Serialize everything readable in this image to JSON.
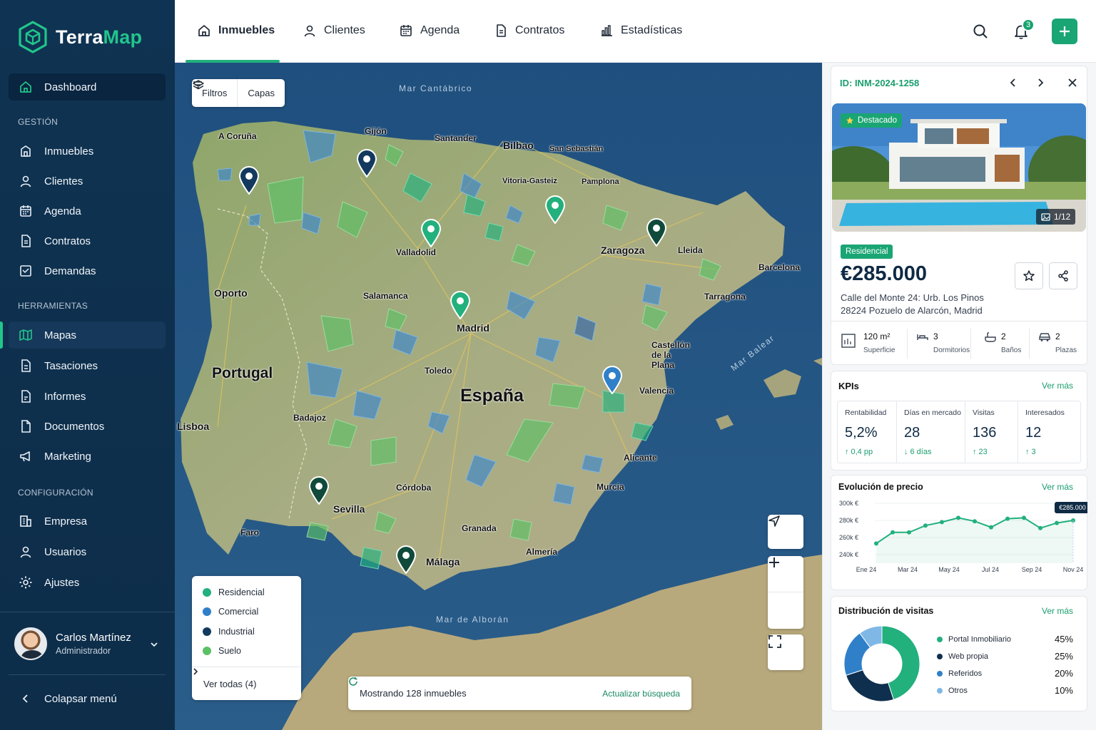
{
  "app": {
    "brand_a": "Terra",
    "brand_b": "Map"
  },
  "sidebar": {
    "dashboard": "Dashboard",
    "sections": {
      "gestion": "GESTIÓN",
      "herramientas": "HERRAMIENTAS",
      "configuracion": "CONFIGURACIÓN"
    },
    "gestion_items": [
      "Inmuebles",
      "Clientes",
      "Agenda",
      "Contratos",
      "Demandas"
    ],
    "herramientas_items": [
      "Mapas",
      "Tasaciones",
      "Informes",
      "Documentos",
      "Marketing"
    ],
    "config_items": [
      "Empresa",
      "Usuarios",
      "Ajustes"
    ],
    "user": {
      "name": "Carlos Martínez",
      "role": "Administrador"
    },
    "collapse": "Colapsar menú"
  },
  "topbar": {
    "tabs": [
      "Inmuebles",
      "Clientes",
      "Agenda",
      "Contratos",
      "Estadísticas"
    ],
    "active_tab": "Inmuebles",
    "notification_count": "3"
  },
  "map": {
    "toolbar": {
      "filters": "Filtros",
      "layers": "Capas"
    },
    "seas": {
      "cantabrico": "Mar Cantábrico",
      "balear": "Mar Balear",
      "alboran": "Mar de Alborán"
    },
    "countries": {
      "portugal": "Portugal",
      "espana": "España"
    },
    "cities": {
      "coruna": "A Coruña",
      "gijon": "Gijón",
      "santander": "Santander",
      "bilbao": "Bilbao",
      "sansebastian": "San Sebastián",
      "vitoria": "Vitoria-Gasteiz",
      "pamplona": "Pamplona",
      "valladolid": "Valladolid",
      "zaragoza": "Zaragoza",
      "lleida": "Lleida",
      "barcelona": "Barcelona",
      "tarragona": "Tarragona",
      "oporto": "Oporto",
      "salamanca": "Salamanca",
      "madrid": "Madrid",
      "castellon": "Castellón de la Plana",
      "toledo": "Toledo",
      "valencia": "Valencia",
      "lisboa": "Lisboa",
      "badajoz": "Badajoz",
      "alicante": "Alicante",
      "cordoba": "Córdoba",
      "murcia": "Murcia",
      "sevilla": "Sevilla",
      "faro": "Faro",
      "granada": "Granada",
      "almeria": "Almería",
      "malaga": "Málaga"
    },
    "legend": {
      "items": [
        {
          "label": "Residencial",
          "color": "#22b07d"
        },
        {
          "label": "Comercial",
          "color": "#2f80c9"
        },
        {
          "label": "Industrial",
          "color": "#133a5e"
        },
        {
          "label": "Suelo",
          "color": "#5cc065"
        }
      ],
      "see_all": "Ver todas (4)"
    },
    "status": {
      "showing": "Mostrando 128 inmuebles",
      "refresh": "Actualizar búsqueda"
    }
  },
  "detail": {
    "id": "ID: INM-2024-1258",
    "featured": "Destacado",
    "photo_count": "1/12",
    "type": "Residencial",
    "price": "€285.000",
    "address_line1": "Calle del Monte 24: Urb. Los Pinos",
    "address_line2": "28224 Pozuelo de Alarcón, Madrid",
    "features": [
      {
        "value": "120 m²",
        "label": "Superficie",
        "icon": "area-icon"
      },
      {
        "value": "3",
        "label": "Dormitorios",
        "icon": "bed-icon"
      },
      {
        "value": "2",
        "label": "Baños",
        "icon": "bath-icon"
      },
      {
        "value": "2",
        "label": "Plazas",
        "icon": "car-icon"
      }
    ],
    "kpis": {
      "title": "KPIs",
      "more": "Ver más",
      "items": [
        {
          "label": "Rentabilidad",
          "value": "5,2%",
          "delta": "0,4 pp",
          "dir": "up"
        },
        {
          "label": "Días en mercado",
          "value": "28",
          "delta": "6 días",
          "dir": "down"
        },
        {
          "label": "Visitas",
          "value": "136",
          "delta": "23",
          "dir": "up"
        },
        {
          "label": "Interesados",
          "value": "12",
          "delta": "3",
          "dir": "up"
        }
      ]
    },
    "price_chart": {
      "title": "Evolución de precio",
      "more": "Ver más"
    },
    "visits_chart": {
      "title": "Distribución de visitas",
      "more": "Ver más"
    }
  },
  "chart_data": [
    {
      "type": "area",
      "title": "Evolución de precio",
      "y_tick_labels": [
        "300k €",
        "280k €",
        "260k €",
        "240k €"
      ],
      "x_tick_labels": [
        "Ene 24",
        "Mar 24",
        "May 24",
        "Jul 24",
        "Sep 24",
        "Nov 24"
      ],
      "ylim": [
        240000,
        300000
      ],
      "x": [
        "Ene 24",
        "Feb 24",
        "Mar 24",
        "Abr 24",
        "May 24",
        "Jun 24",
        "Jul 24",
        "Ago 24",
        "Sep 24",
        "Oct 24",
        "Nov 24",
        "Dic 24"
      ],
      "values": [
        253000,
        266000,
        266000,
        274000,
        278000,
        283000,
        279000,
        272000,
        282000,
        283000,
        271000,
        277000,
        280000
      ],
      "callout": "€285.000",
      "color": "#22b07d"
    },
    {
      "type": "pie",
      "title": "Distribución de visitas",
      "slices": [
        {
          "label": "Portal Inmobiliario",
          "value": 45,
          "pct": "45%",
          "color": "#22b07d"
        },
        {
          "label": "Web propia",
          "value": 25,
          "pct": "25%",
          "color": "#0f2f4e"
        },
        {
          "label": "Referidos",
          "value": 20,
          "pct": "20%",
          "color": "#2f80c9"
        },
        {
          "label": "Otros",
          "value": 10,
          "pct": "10%",
          "color": "#7fb8e6"
        }
      ]
    }
  ]
}
